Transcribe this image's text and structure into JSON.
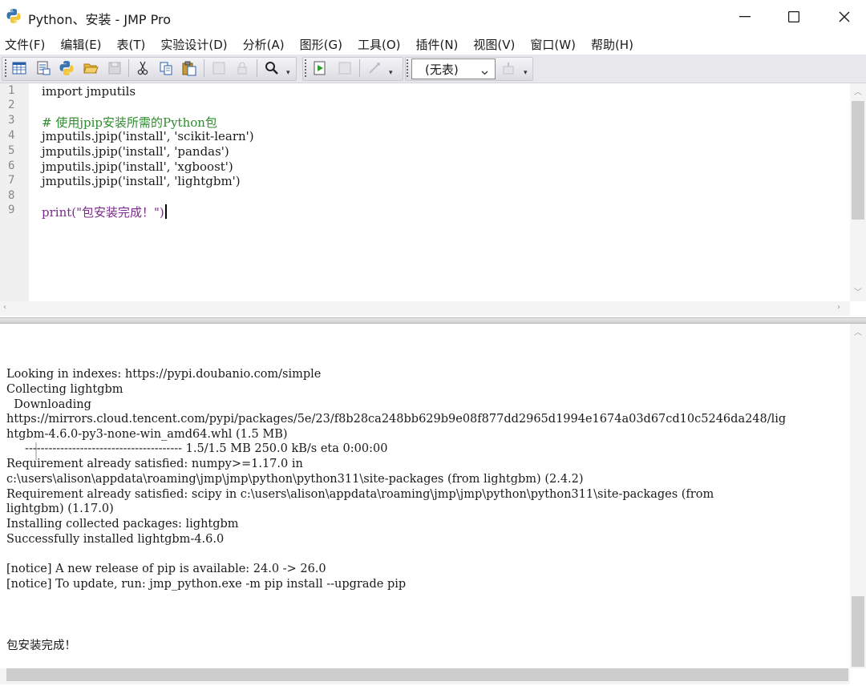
{
  "window": {
    "title": "Python、安装 - JMP Pro"
  },
  "menubar": {
    "items": [
      "文件(F)",
      "编辑(E)",
      "表(T)",
      "实验设计(D)",
      "分析(A)",
      "图形(G)",
      "工具(O)",
      "插件(N)",
      "视图(V)",
      "窗口(W)",
      "帮助(H)"
    ]
  },
  "toolbar": {
    "table_select": "(无表)"
  },
  "editor": {
    "line_numbers": [
      "1",
      "2",
      "3",
      "4",
      "5",
      "6",
      "7",
      "8",
      "9"
    ],
    "lines": [
      "import jmputils",
      "",
      "# 使用jpip安装所需的Python包",
      "jmputils.jpip('install', 'scikit-learn')",
      "jmputils.jpip('install', 'pandas')",
      "jmputils.jpip('install', 'xgboost')",
      "jmputils.jpip('install', 'lightgbm')",
      "",
      "print(\"包安装完成！\")"
    ]
  },
  "output": {
    "lines": [
      "Looking in indexes: https://pypi.doubanio.com/simple",
      "Collecting lightgbm",
      "  Downloading",
      "https://mirrors.cloud.tencent.com/pypi/packages/5e/23/f8b28ca248bb629b9e08f877dd2965d1994e1674a03d67cd10c5246da248/lig",
      "htgbm-4.6.0-py3-none-win_amd64.whl (1.5 MB)",
      "     ---------------------------------------- 1.5/1.5 MB 250.0 kB/s eta 0:00:00",
      "Requirement already satisfied: numpy>=1.17.0 in",
      "c:\\users\\alison\\appdata\\roaming\\jmp\\jmp\\python\\python311\\site-packages (from lightgbm) (2.4.2)",
      "Requirement already satisfied: scipy in c:\\users\\alison\\appdata\\roaming\\jmp\\jmp\\python\\python311\\site-packages (from",
      "lightgbm) (1.17.0)",
      "Installing collected packages: lightgbm",
      "Successfully installed lightgbm-4.6.0",
      "",
      "[notice] A new release of pip is available: 24.0 -> 26.0",
      "[notice] To update, run: jmp_python.exe -m pip install --upgrade pip",
      "",
      "",
      "",
      "包安装完成！"
    ]
  }
}
